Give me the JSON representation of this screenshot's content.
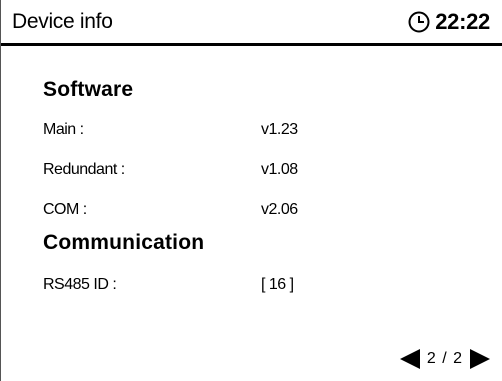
{
  "header": {
    "title": "Device info",
    "time": "22:22",
    "clock_icon": "clock-icon"
  },
  "software": {
    "heading": "Software",
    "rows": [
      {
        "label": "Main :",
        "value": "v1.23"
      },
      {
        "label": "Redundant :",
        "value": "v1.08"
      },
      {
        "label": "COM :",
        "value": "v2.06"
      }
    ]
  },
  "communication": {
    "heading": "Communication",
    "rows": [
      {
        "label": "RS485 ID :",
        "value": "[ 16 ]"
      }
    ]
  },
  "pager": {
    "text": "2 / 2",
    "prev_icon": "arrow-left-icon",
    "next_icon": "arrow-right-icon"
  }
}
